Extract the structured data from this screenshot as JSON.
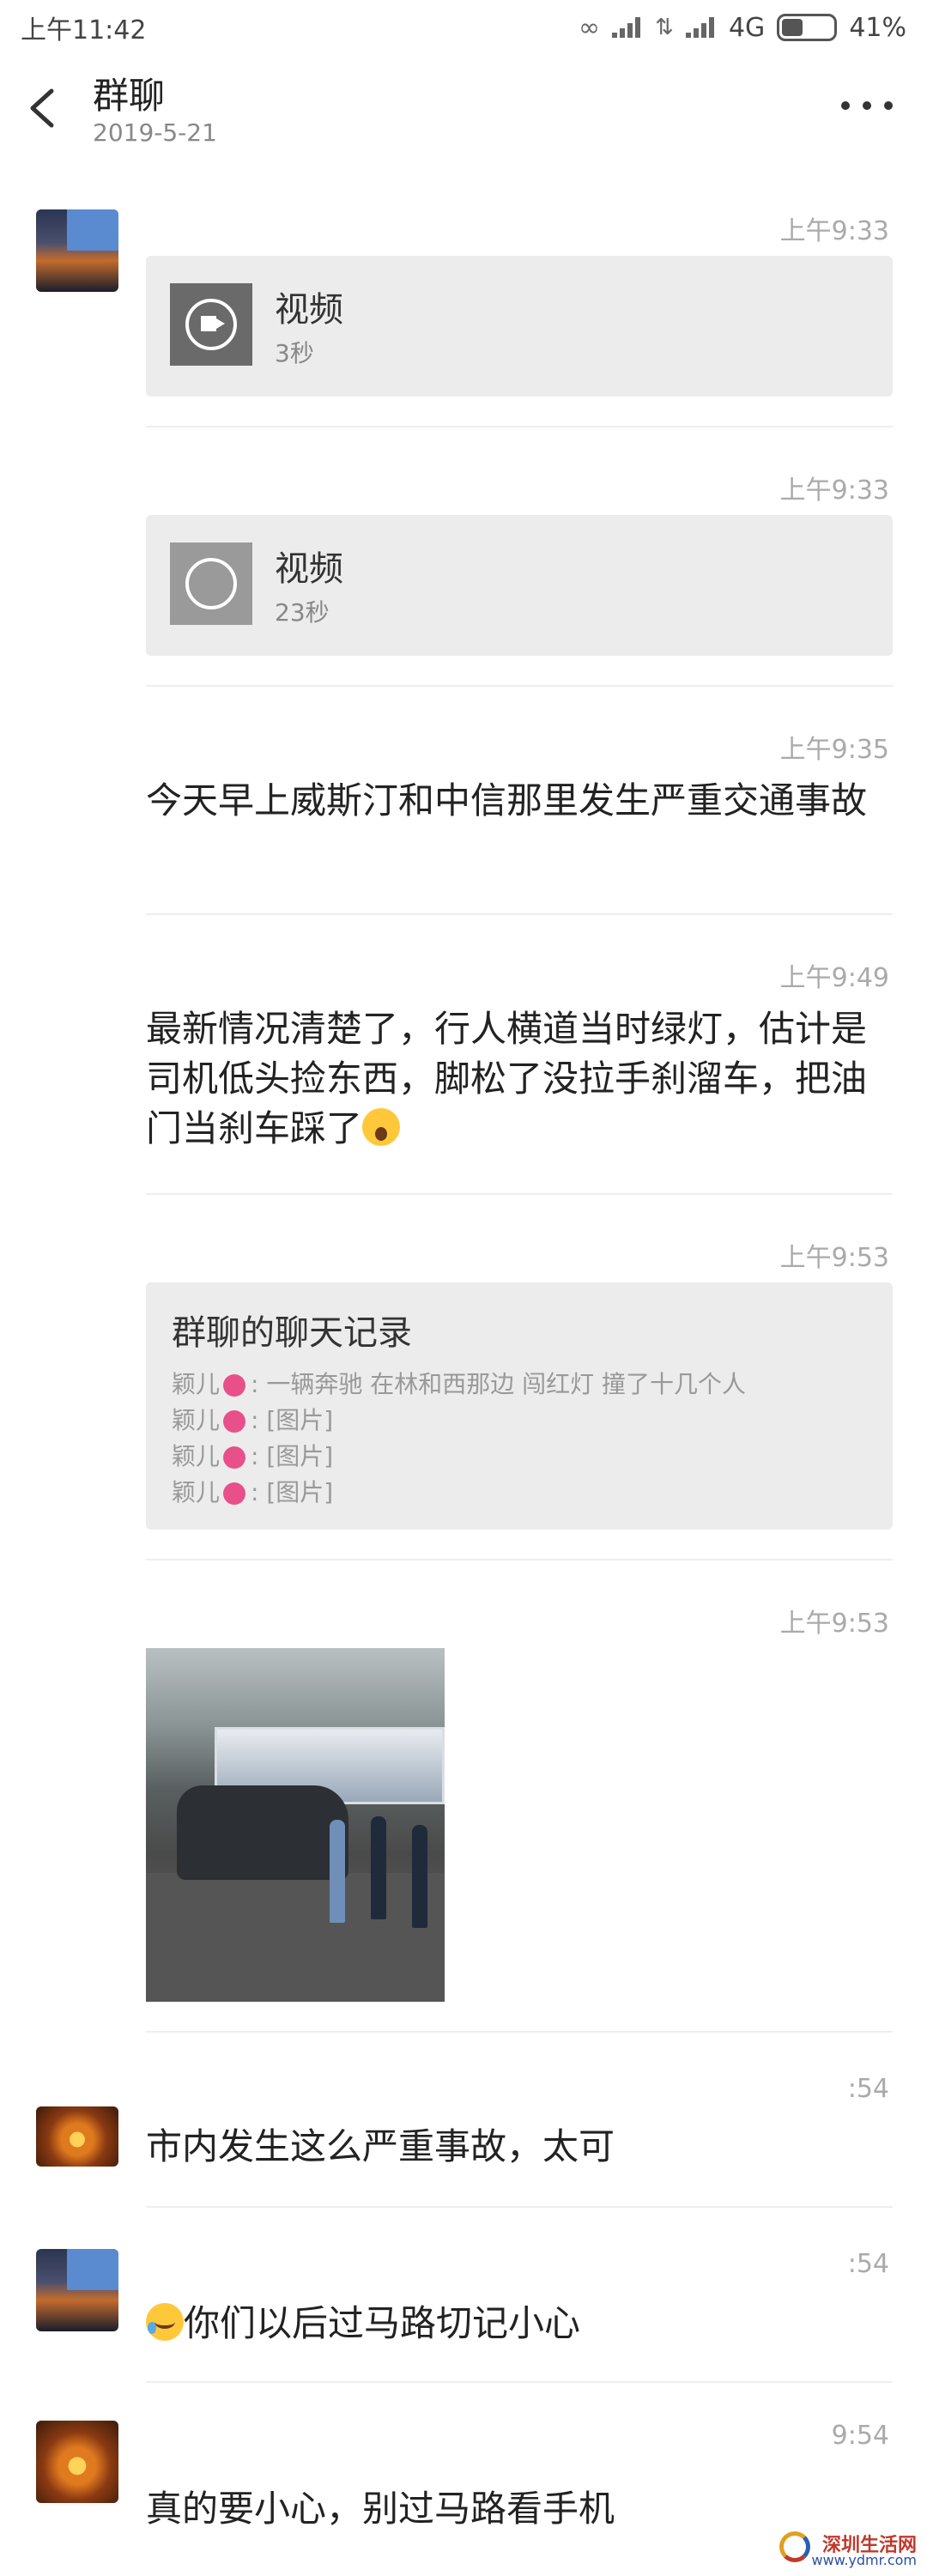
{
  "status_bar": {
    "time": "上午11:42",
    "network": "4G",
    "battery": "41%",
    "battery_level": 0.41
  },
  "header": {
    "title": "群聊",
    "date": "2019-5-21",
    "icons": {
      "back": "back-arrow-icon",
      "more": "more-icon"
    }
  },
  "messages": [
    {
      "time": "上午9:33",
      "type": "video",
      "title": "视频",
      "duration": "3秒"
    },
    {
      "time": "上午9:33",
      "type": "video",
      "title": "视频",
      "duration": "23秒"
    },
    {
      "time": "上午9:35",
      "type": "text",
      "text": "今天早上威斯汀和中信那里发生严重交通事故"
    },
    {
      "time": "上午9:49",
      "type": "text",
      "text": "最新情况清楚了，行人横道当时绿灯，估计是司机低头捡东西，脚松了没拉手刹溜车，把油门当刹车踩了"
    },
    {
      "time": "上午9:53",
      "type": "record",
      "title": "群聊的聊天记录",
      "lines": [
        {
          "sender": "颖儿",
          "text": ": 一辆奔驰 在林和西那边 闯红灯  撞了十几个人"
        },
        {
          "sender": "颖儿",
          "text": ": [图片]"
        },
        {
          "sender": "颖儿",
          "text": ": [图片]"
        },
        {
          "sender": "颖儿",
          "text": ": [图片]"
        }
      ]
    },
    {
      "time": "上午9:53",
      "type": "image"
    },
    {
      "time": ":54",
      "type": "text",
      "text": "市内发生这么严重事故，太可"
    },
    {
      "time": ":54",
      "type": "text",
      "text": "你们以后过马路切记小心"
    },
    {
      "time": "9:54",
      "type": "text",
      "text": "真的要小心，别过马路看手机"
    }
  ],
  "watermark": {
    "name": "深圳生活网",
    "url": "www.ydmr.com"
  }
}
